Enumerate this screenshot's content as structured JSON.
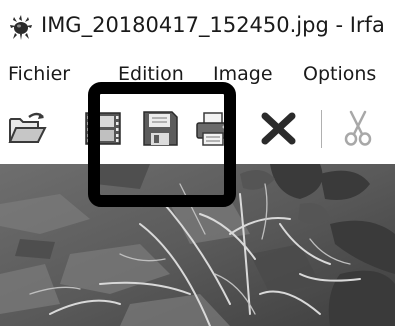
{
  "window": {
    "title": "IMG_20180417_152450.jpg - Irfa",
    "app_icon": "irfanview-icon"
  },
  "menu": {
    "items": [
      {
        "label": "Fichier"
      },
      {
        "label": "Edition"
      },
      {
        "label": "Image"
      },
      {
        "label": "Options"
      }
    ]
  },
  "toolbar": {
    "buttons": [
      {
        "name": "open",
        "icon": "open-folder-icon"
      },
      {
        "name": "slideshow",
        "icon": "film-strip-icon"
      },
      {
        "name": "save",
        "icon": "floppy-disk-icon"
      },
      {
        "name": "print",
        "icon": "printer-icon"
      },
      {
        "name": "delete",
        "icon": "delete-x-icon"
      },
      {
        "name": "cut",
        "icon": "scissors-icon",
        "disabled": true
      }
    ]
  },
  "colors": {
    "annotation_frame": "#000000",
    "image_tone": "#5a5a5a"
  }
}
